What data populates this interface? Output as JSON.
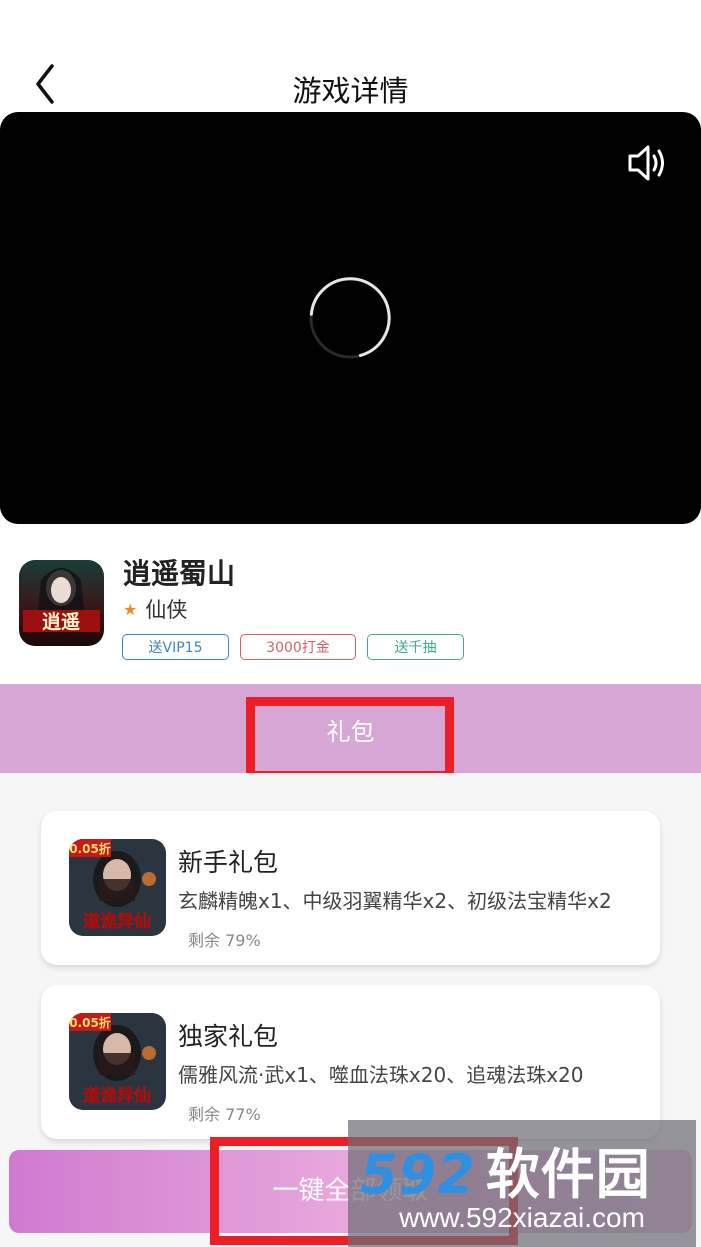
{
  "header": {
    "title": "游戏详情"
  },
  "game": {
    "name": "逍遥蜀山",
    "genre": "仙侠",
    "icon_text": "逍遥",
    "tags": [
      "送VIP15",
      "3000打金",
      "送千抽"
    ]
  },
  "tab": {
    "label": "礼包"
  },
  "gifts": [
    {
      "title": "新手礼包",
      "desc": "玄麟精魄x1、中级羽翼精华x2、初级法宝精华x2",
      "remaining": "剩余 79%",
      "badge": "0.05折",
      "icon_text": "道诡异仙"
    },
    {
      "title": "独家礼包",
      "desc": "儒雅风流·武x1、噬血法珠x20、追魂法珠x20",
      "remaining": "剩余 77%",
      "badge": "0.05折",
      "icon_text": "道诡异仙"
    }
  ],
  "claim_button": {
    "label": "一键全部领取"
  },
  "watermark": {
    "logo_num": "592",
    "logo_cn": "软件园",
    "url": "www.592xiazai.com"
  },
  "colors": {
    "tab_bg": "#d6a7d5",
    "highlight": "#ec1f27",
    "tag_blue": "#3b86c4",
    "tag_red": "#d9606a",
    "tag_green": "#3bb183"
  }
}
